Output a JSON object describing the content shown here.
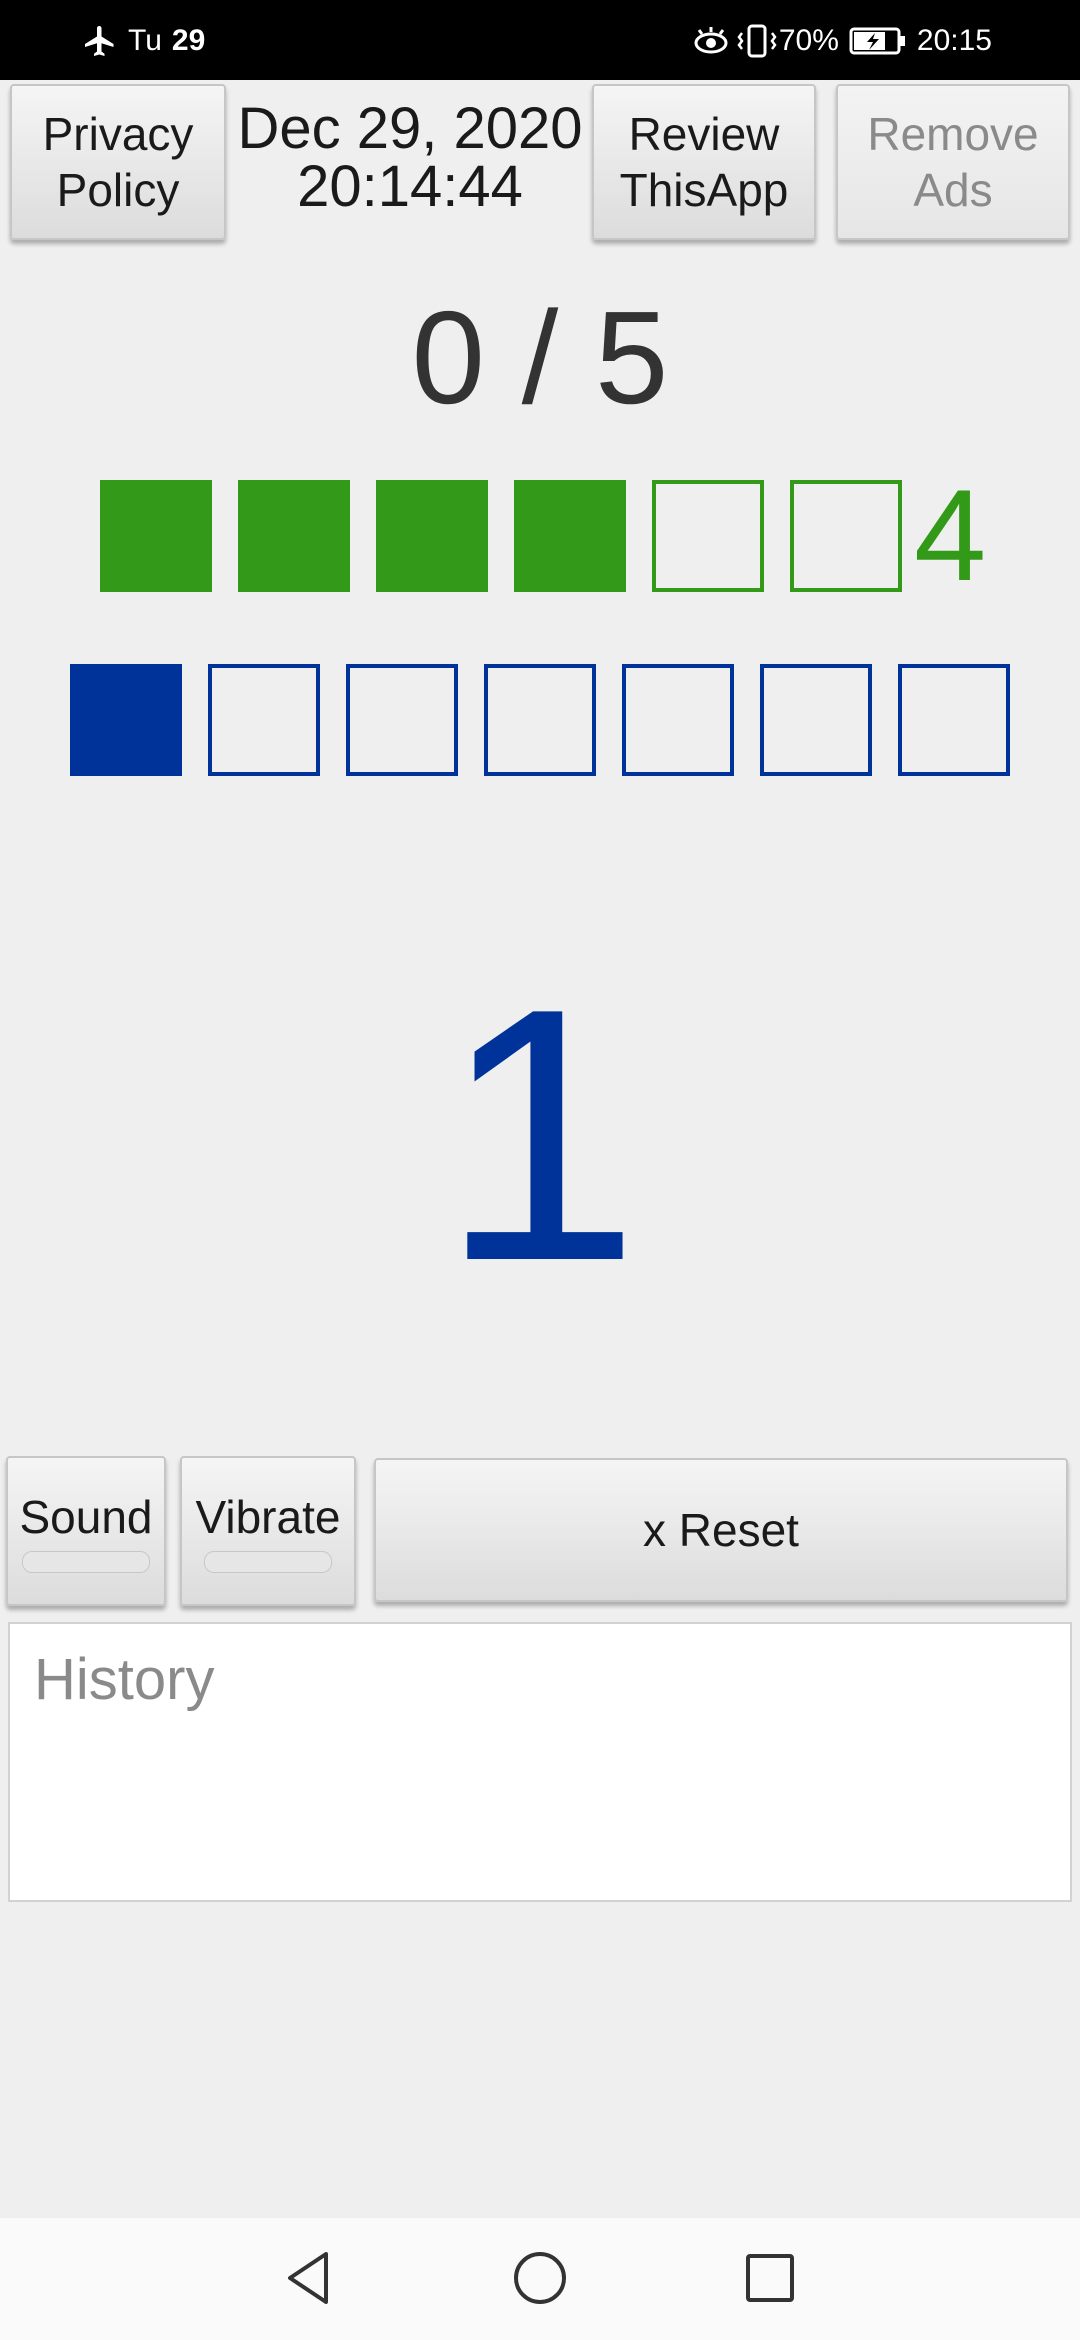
{
  "status_bar": {
    "day": "Tu",
    "date_num": "29",
    "battery": "70%",
    "time": "20:15"
  },
  "top_bar": {
    "privacy_line1": "Privacy",
    "privacy_line2": "Policy",
    "date": "Dec 29, 2020",
    "time": "20:14:44",
    "review_line1": "Review",
    "review_line2": "ThisApp",
    "remove_line1": "Remove",
    "remove_line2": "Ads"
  },
  "score": "0 / 5",
  "green_row": {
    "filled": 4,
    "total": 6,
    "count_label": "4",
    "color": "#339919"
  },
  "blue_row": {
    "filled": 1,
    "total": 7,
    "color": "#003399"
  },
  "big_number": "1",
  "controls": {
    "sound": "Sound",
    "vibrate": "Vibrate",
    "reset": "x Reset"
  },
  "history": {
    "placeholder": "History"
  }
}
